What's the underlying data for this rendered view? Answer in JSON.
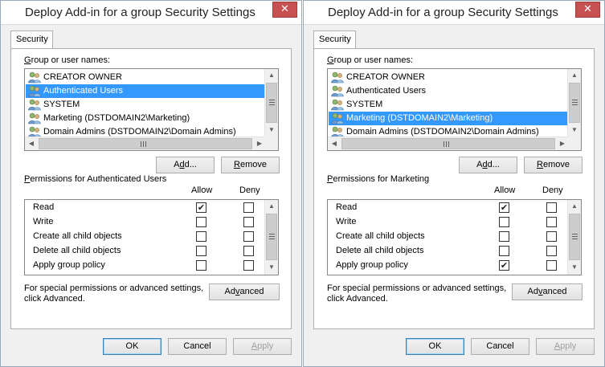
{
  "dialogs": [
    {
      "title": "Deploy Add-in for a group Security Settings",
      "close_glyph": "✕",
      "tab": "Security",
      "group_label_first": "G",
      "group_label_rest": "roup or user names:",
      "users": [
        {
          "name": "CREATOR OWNER",
          "selected": false
        },
        {
          "name": "Authenticated Users",
          "selected": true
        },
        {
          "name": "SYSTEM",
          "selected": false
        },
        {
          "name": "Marketing (DSTDOMAIN2\\Marketing)",
          "selected": false
        },
        {
          "name": "Domain Admins (DSTDOMAIN2\\Domain Admins)",
          "selected": false
        }
      ],
      "add_before": "A",
      "add_ul": "d",
      "add_after": "d...",
      "remove_first": "R",
      "remove_rest": "emove",
      "perm_label_first": "P",
      "perm_label_rest": "ermissions for Authenticated Users",
      "allow_header": "Allow",
      "deny_header": "Deny",
      "permissions": [
        {
          "name": "Read",
          "allow": true,
          "deny": false
        },
        {
          "name": "Write",
          "allow": false,
          "deny": false
        },
        {
          "name": "Create all child objects",
          "allow": false,
          "deny": false
        },
        {
          "name": "Delete all child objects",
          "allow": false,
          "deny": false
        },
        {
          "name": "Apply group policy",
          "allow": false,
          "deny": false
        }
      ],
      "special_text": "For special permissions or advanced settings, click Advanced.",
      "advanced_before": "Ad",
      "advanced_ul": "v",
      "advanced_after": "anced",
      "ok_label": "OK",
      "cancel_label": "Cancel",
      "apply_first": "A",
      "apply_rest": "pply"
    },
    {
      "title": "Deploy Add-in for a group Security Settings",
      "close_glyph": "✕",
      "tab": "Security",
      "group_label_first": "G",
      "group_label_rest": "roup or user names:",
      "users": [
        {
          "name": "CREATOR OWNER",
          "selected": false
        },
        {
          "name": "Authenticated Users",
          "selected": false
        },
        {
          "name": "SYSTEM",
          "selected": false
        },
        {
          "name": "Marketing (DSTDOMAIN2\\Marketing)",
          "selected": true
        },
        {
          "name": "Domain Admins (DSTDOMAIN2\\Domain Admins)",
          "selected": false
        }
      ],
      "add_before": "A",
      "add_ul": "d",
      "add_after": "d...",
      "remove_first": "R",
      "remove_rest": "emove",
      "perm_label_first": "P",
      "perm_label_rest": "ermissions for Marketing",
      "allow_header": "Allow",
      "deny_header": "Deny",
      "permissions": [
        {
          "name": "Read",
          "allow": true,
          "deny": false
        },
        {
          "name": "Write",
          "allow": false,
          "deny": false
        },
        {
          "name": "Create all child objects",
          "allow": false,
          "deny": false
        },
        {
          "name": "Delete all child objects",
          "allow": false,
          "deny": false
        },
        {
          "name": "Apply group policy",
          "allow": true,
          "deny": false
        }
      ],
      "special_text": "For special permissions or advanced settings, click Advanced.",
      "advanced_before": "Ad",
      "advanced_ul": "v",
      "advanced_after": "anced",
      "ok_label": "OK",
      "cancel_label": "Cancel",
      "apply_first": "A",
      "apply_rest": "pply"
    }
  ],
  "icons": {
    "user_group": "users-group-icon",
    "scroll_up": "scroll-up-arrow-icon",
    "scroll_down": "scroll-down-arrow-icon",
    "scroll_left": "scroll-left-arrow-icon",
    "scroll_right": "scroll-right-arrow-icon",
    "checkmark": "checkmark-icon",
    "close": "close-icon"
  },
  "colors": {
    "selection": "#3399ff",
    "close_button": "#c75050",
    "dialog_bg": "#f0f0f0",
    "default_button_border": "#3c7fb1"
  }
}
